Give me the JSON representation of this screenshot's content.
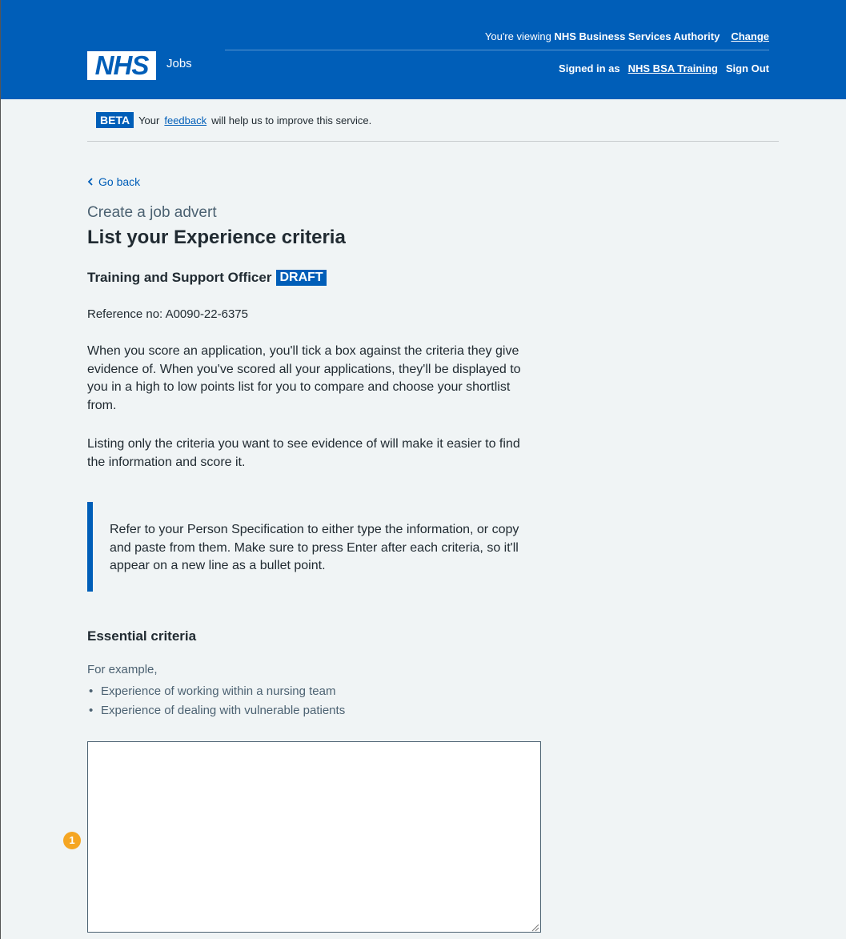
{
  "header": {
    "viewing_prefix": "You're viewing",
    "organisation": "NHS Business Services Authority",
    "change_link": "Change",
    "logo_text": "NHS",
    "service_name": "Jobs",
    "signed_in_prefix": "Signed in as",
    "user_link": "NHS BSA Training",
    "sign_out": "Sign Out"
  },
  "beta_banner": {
    "tag": "BETA",
    "text_before": "Your",
    "link": "feedback",
    "text_after": "will help us to improve this service."
  },
  "back_link": "Go back",
  "caption": "Create a job advert",
  "title": "List your Experience criteria",
  "job": {
    "name": "Training and Support Officer",
    "status": "DRAFT"
  },
  "reference": "Reference no: A0090-22-6375",
  "paragraphs": {
    "p1": "When you score an application, you'll tick a box against the criteria they give evidence of. When you've scored all your applications, they'll be displayed to you in a high to low points list for you to compare and choose your shortlist from.",
    "p2": "Listing only the criteria you want to see evidence of will make it easier to find the information and score it."
  },
  "inset_text": "Refer to your Person Specification to either type the information, or copy and paste from them. Make sure to press Enter after each criteria, so it'll appear on a new line as a bullet point.",
  "essential": {
    "heading": "Essential criteria",
    "hint": "For example,",
    "examples": [
      "Experience of working within a nursing team",
      "Experience of dealing with vulnerable patients"
    ],
    "value": ""
  },
  "annotation_marker": "1",
  "colors": {
    "nhs_blue": "#005eb8",
    "background": "#f0f4f5",
    "text": "#212b32",
    "secondary_text": "#4c6272",
    "marker": "#f5a623"
  }
}
